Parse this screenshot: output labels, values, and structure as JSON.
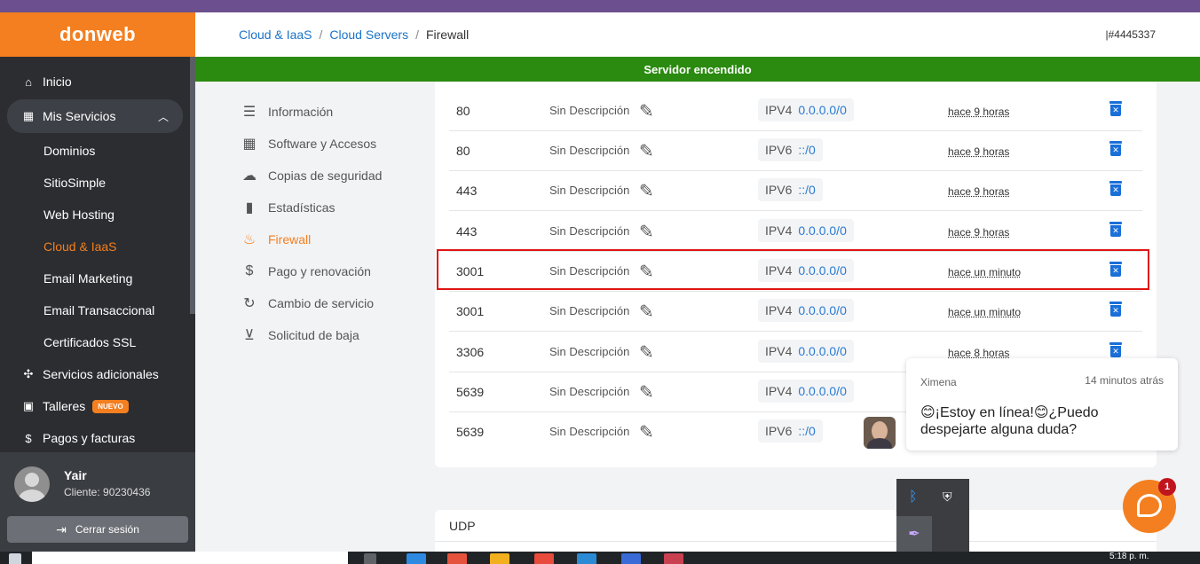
{
  "brand": {
    "name": "donweb",
    "color": "#f47f20"
  },
  "sidebar": {
    "items": [
      {
        "label": "Inicio",
        "icon": "home-icon",
        "glyph": "⌂"
      },
      {
        "label": "Mis Servicios",
        "icon": "grid-icon",
        "glyph": "▦",
        "expanded": true
      },
      {
        "label": "Dominios"
      },
      {
        "label": "SitioSimple"
      },
      {
        "label": "Web Hosting"
      },
      {
        "label": "Cloud & IaaS",
        "active": true
      },
      {
        "label": "Email Marketing"
      },
      {
        "label": "Email Transaccional"
      },
      {
        "label": "Certificados SSL"
      },
      {
        "label": "Servicios adicionales",
        "icon": "puzzle-icon",
        "glyph": "✣"
      },
      {
        "label": "Talleres",
        "icon": "briefcase-icon",
        "glyph": "▣",
        "badge": "NUEVO"
      },
      {
        "label": "Pagos y facturas",
        "icon": "dollar-icon",
        "glyph": "$"
      }
    ]
  },
  "user": {
    "name": "Yair",
    "client": "Cliente: 90230436",
    "logout_label": "Cerrar sesión"
  },
  "header": {
    "breadcrumb": [
      "Cloud & IaaS",
      "Cloud Servers",
      "Firewall"
    ],
    "server_id": "|#4445337"
  },
  "status": {
    "text": "Servidor encendido",
    "color": "#2b8a10"
  },
  "submenu": [
    {
      "label": "Información",
      "icon": "document-icon",
      "glyph": "☰"
    },
    {
      "label": "Software y Accesos",
      "icon": "apps-icon",
      "glyph": "▦"
    },
    {
      "label": "Copias de seguridad",
      "icon": "cloud-upload-icon",
      "glyph": "☁"
    },
    {
      "label": "Estadísticas",
      "icon": "bar-chart-icon",
      "glyph": "▮"
    },
    {
      "label": "Firewall",
      "icon": "fire-icon",
      "glyph": "♨",
      "active": true
    },
    {
      "label": "Pago y renovación",
      "icon": "dollar-circle-icon",
      "glyph": "$"
    },
    {
      "label": "Cambio de servicio",
      "icon": "refresh-icon",
      "glyph": "↻"
    },
    {
      "label": "Solicitud de baja",
      "icon": "download-circle-icon",
      "glyph": "⊻"
    }
  ],
  "firewall": {
    "rows": [
      {
        "port": "80",
        "desc": "Sin Descripción",
        "ipver": "IPV4",
        "addr": "0.0.0.0/0",
        "time": "hace 9 horas"
      },
      {
        "port": "80",
        "desc": "Sin Descripción",
        "ipver": "IPV6",
        "addr": "::/0",
        "time": "hace 9 horas"
      },
      {
        "port": "443",
        "desc": "Sin Descripción",
        "ipver": "IPV6",
        "addr": "::/0",
        "time": "hace 9 horas"
      },
      {
        "port": "443",
        "desc": "Sin Descripción",
        "ipver": "IPV4",
        "addr": "0.0.0.0/0",
        "time": "hace 9 horas"
      },
      {
        "port": "3001",
        "desc": "Sin Descripción",
        "ipver": "IPV4",
        "addr": "0.0.0.0/0",
        "time": "hace un minuto",
        "highlighted": true
      },
      {
        "port": "3001",
        "desc": "Sin Descripción",
        "ipver": "IPV4",
        "addr": "0.0.0.0/0",
        "time": "hace un minuto"
      },
      {
        "port": "3306",
        "desc": "Sin Descripción",
        "ipver": "IPV4",
        "addr": "0.0.0.0/0",
        "time": "hace 8 horas"
      },
      {
        "port": "5639",
        "desc": "Sin Descripción",
        "ipver": "IPV4",
        "addr": "0.0.0.0/0",
        "time": ""
      },
      {
        "port": "5639",
        "desc": "Sin Descripción",
        "ipver": "IPV6",
        "addr": "::/0",
        "time": ""
      }
    ],
    "udp_title": "UDP"
  },
  "chat": {
    "agent": "Ximena",
    "time": "14 minutos atrás",
    "message": "😊¡Estoy en línea!😊¿Puedo despejarte alguna duda?",
    "notifications": "1"
  },
  "taskbar": {
    "clock": "5:18 p. m."
  }
}
